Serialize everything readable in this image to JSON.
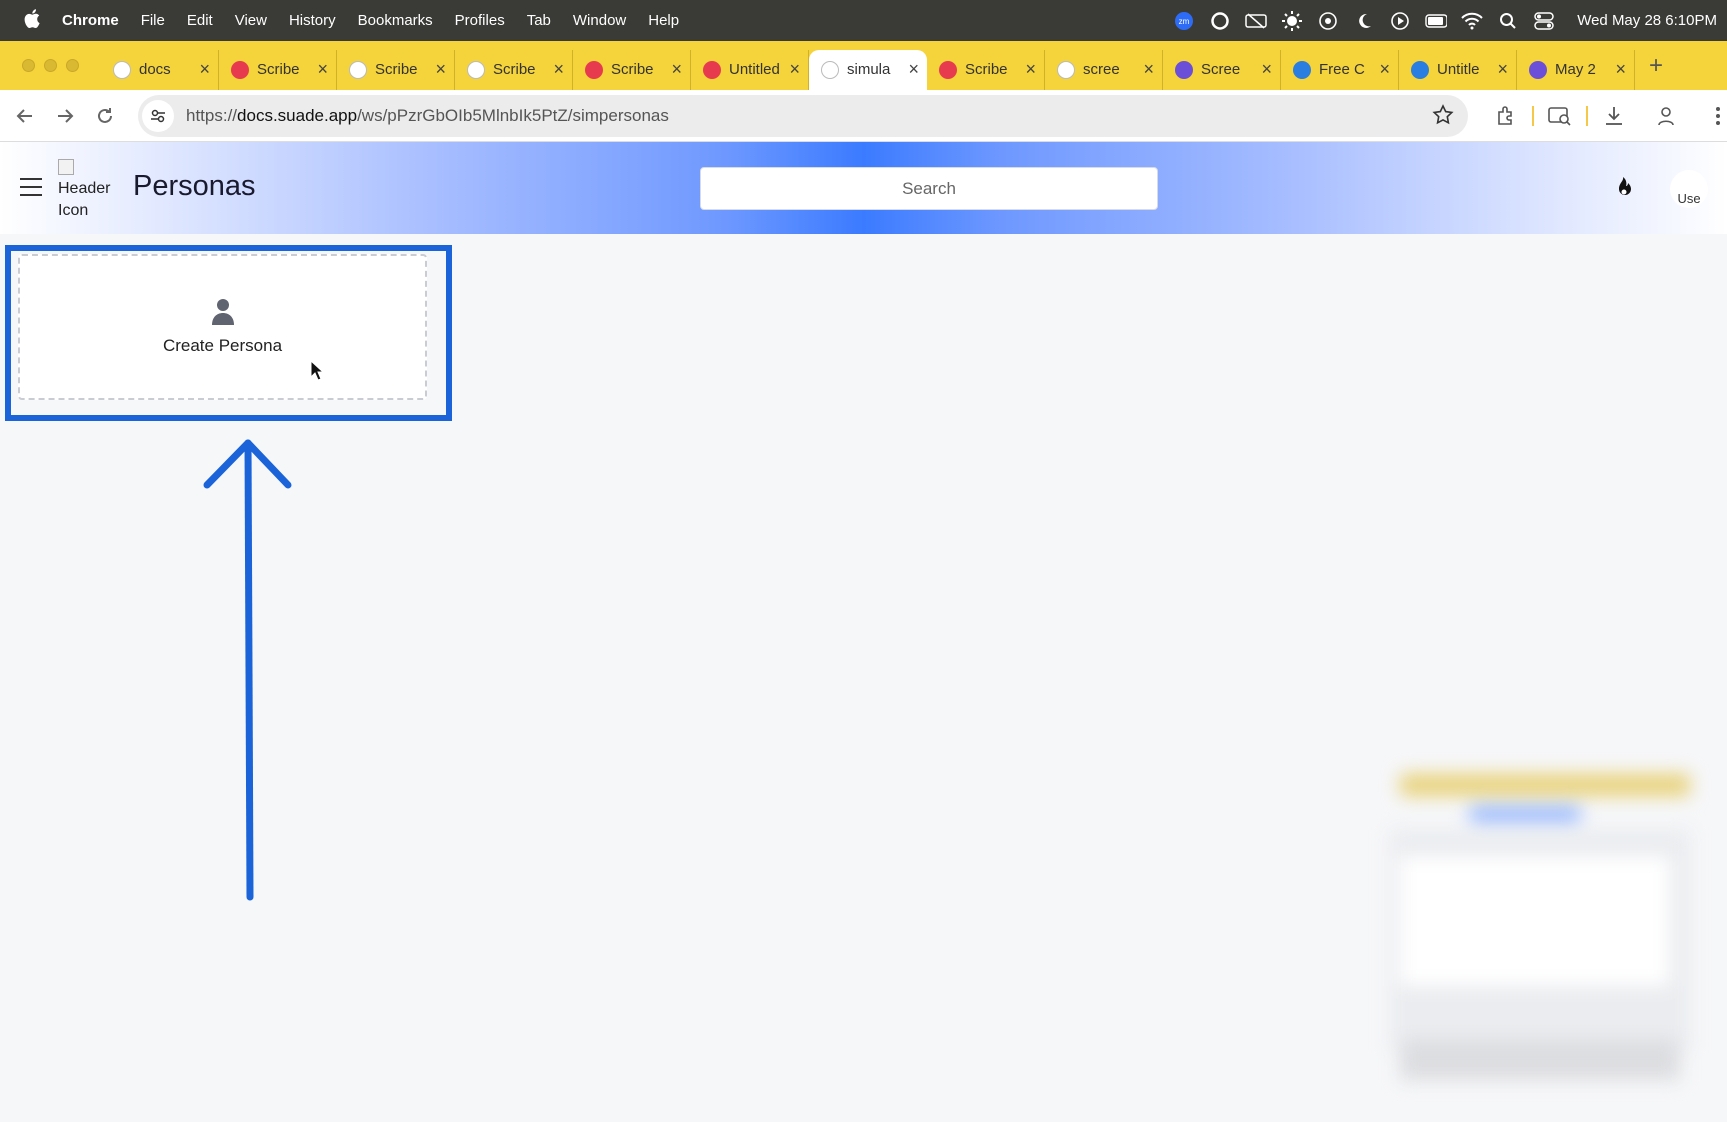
{
  "menubar": {
    "app": "Chrome",
    "items": [
      "File",
      "Edit",
      "View",
      "History",
      "Bookmarks",
      "Profiles",
      "Tab",
      "Window",
      "Help"
    ],
    "clock": "Wed May 28  6:10PM"
  },
  "tabs": [
    {
      "title": "docs",
      "favicon": "suade-icon",
      "color": "#ffffff"
    },
    {
      "title": "Scribe",
      "favicon": "scribe-icon",
      "color": "#e83a4f"
    },
    {
      "title": "Scribe",
      "favicon": "rainbow-icon",
      "color": "#ffffff"
    },
    {
      "title": "Scribe",
      "favicon": "rainbow-icon",
      "color": "#ffffff"
    },
    {
      "title": "Scribe",
      "favicon": "scribe-icon",
      "color": "#e83a4f"
    },
    {
      "title": "Untitled",
      "favicon": "scribe-icon",
      "color": "#e83a4f"
    },
    {
      "title": "simula",
      "favicon": "suade-icon",
      "color": "#ffffff",
      "active": true
    },
    {
      "title": "Scribe",
      "favicon": "scribe-icon",
      "color": "#e83a4f"
    },
    {
      "title": "scree",
      "favicon": "google-icon",
      "color": "#ffffff"
    },
    {
      "title": "Scree",
      "favicon": "claude-icon",
      "color": "#6b4fd8"
    },
    {
      "title": "Free C",
      "favicon": "canva-icon",
      "color": "#2a7de1"
    },
    {
      "title": "Untitle",
      "favicon": "canva-icon",
      "color": "#2a7de1"
    },
    {
      "title": "May 2",
      "favicon": "claude-icon",
      "color": "#6b4fd8"
    }
  ],
  "address": {
    "scheme": "https://",
    "host": "docs.suade.app",
    "path": "/ws/pPzrGbOIb5MlnbIk5PtZ/simpersonas"
  },
  "header": {
    "icon_alt": "Header Icon",
    "title": "Personas",
    "search_placeholder": "Search",
    "avatar_alt": "Use"
  },
  "content": {
    "create_label": "Create Persona"
  },
  "colors": {
    "highlight": "#1a63d8",
    "tabstrip": "#f5d33a",
    "header_accent": "#3b7bff"
  }
}
